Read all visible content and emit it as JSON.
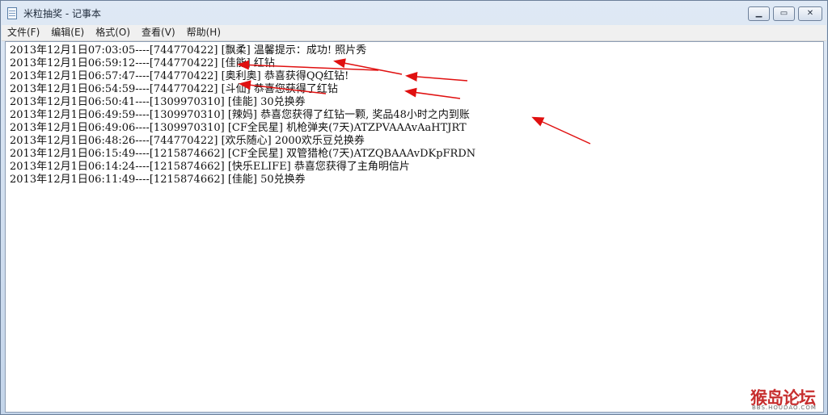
{
  "window": {
    "title": "米粒抽奖 - 记事本"
  },
  "caption_buttons": {
    "minimize": "▁",
    "maximize": "▭",
    "close": "✕"
  },
  "menu": [
    {
      "label": "文件(F)"
    },
    {
      "label": "编辑(E)"
    },
    {
      "label": "格式(O)"
    },
    {
      "label": "查看(V)"
    },
    {
      "label": "帮助(H)"
    }
  ],
  "lines": [
    "2013年12月1日07:03:05----[744770422] [飘柔] 温馨提示：成功! 照片秀",
    "2013年12月1日06:59:12----[744770422] [佳能] 红钻",
    "2013年12月1日06:57:47----[744770422] [奥利奥] 恭喜获得QQ红钻!",
    "2013年12月1日06:54:59----[744770422] [斗仙] 恭喜您获得了红钻",
    "2013年12月1日06:50:41----[1309970310] [佳能] 30兑换券",
    "2013年12月1日06:49:59----[1309970310] [辣妈] 恭喜您获得了红钻一颗, 奖品48小时之内到账",
    "2013年12月1日06:49:06----[1309970310] [CF全民星] 机枪弹夹(7天)ATZPVAAAvAaHTJRT",
    "2013年12月1日06:48:26----[744770422] [欢乐随心] 2000欢乐豆兑换券",
    "2013年12月1日06:15:49----[1215874662] [CF全民星] 双管猎枪(7天)ATZQBAAAvDKpFRDN",
    "2013年12月1日06:14:24----[1215874662] [快乐ELIFE] 恭喜您获得了主角明信片",
    "2013年12月1日06:11:49----[1215874662] [佳能] 50兑换券"
  ],
  "watermark": {
    "text": "猴岛论坛",
    "url": "BBS.HOUDAO.COM"
  },
  "colors": {
    "arrow": "#e01010",
    "watermark": "#c72f2f"
  }
}
